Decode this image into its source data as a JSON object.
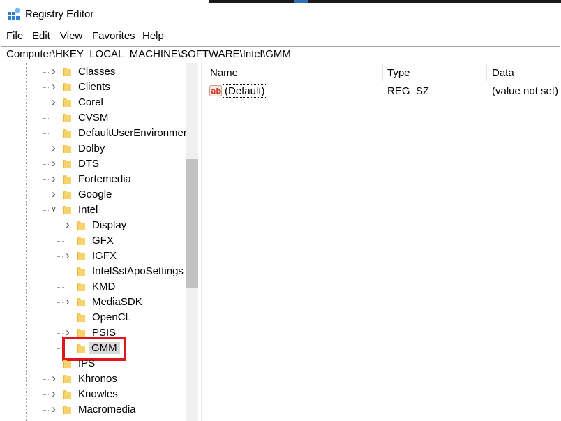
{
  "window": {
    "title": "Registry Editor"
  },
  "menu": [
    "File",
    "Edit",
    "View",
    "Favorites",
    "Help"
  ],
  "address": {
    "path": "Computer\\HKEY_LOCAL_MACHINE\\SOFTWARE\\Intel\\GMM"
  },
  "tree": {
    "items": [
      {
        "label": "Classes",
        "expandable": true
      },
      {
        "label": "Clients",
        "expandable": true
      },
      {
        "label": "Corel",
        "expandable": true
      },
      {
        "label": "CVSM",
        "expandable": false
      },
      {
        "label": "DefaultUserEnvironmer",
        "expandable": false
      },
      {
        "label": "Dolby",
        "expandable": true
      },
      {
        "label": "DTS",
        "expandable": true
      },
      {
        "label": "Fortemedia",
        "expandable": true
      },
      {
        "label": "Google",
        "expandable": true
      },
      {
        "label": "Intel",
        "expandable": true,
        "expanded": true
      },
      {
        "label": "Display",
        "expandable": true
      },
      {
        "label": "GFX",
        "expandable": false
      },
      {
        "label": "IGFX",
        "expandable": true
      },
      {
        "label": "IntelSstApoSettings",
        "expandable": false
      },
      {
        "label": "KMD",
        "expandable": false
      },
      {
        "label": "MediaSDK",
        "expandable": true
      },
      {
        "label": "OpenCL",
        "expandable": false
      },
      {
        "label": "PSIS",
        "expandable": true
      },
      {
        "label": "GMM",
        "expandable": false,
        "selected": true
      },
      {
        "label": "IPS",
        "expandable": false
      },
      {
        "label": "Khronos",
        "expandable": true
      },
      {
        "label": "Knowles",
        "expandable": true
      },
      {
        "label": "Macromedia",
        "expandable": true
      }
    ]
  },
  "list": {
    "columns": [
      "Name",
      "Type",
      "Data"
    ],
    "rows": [
      {
        "name": "(Default)",
        "type": "REG_SZ",
        "data": "(value not set)"
      }
    ]
  },
  "colors": {
    "highlight": "#e0161f",
    "folder": "#f2c75c",
    "selection": "#d9d9d9"
  },
  "icons": {
    "app": "registry-editor-icon",
    "folder": "folder-icon",
    "value": "reg-sz-ab-icon"
  }
}
